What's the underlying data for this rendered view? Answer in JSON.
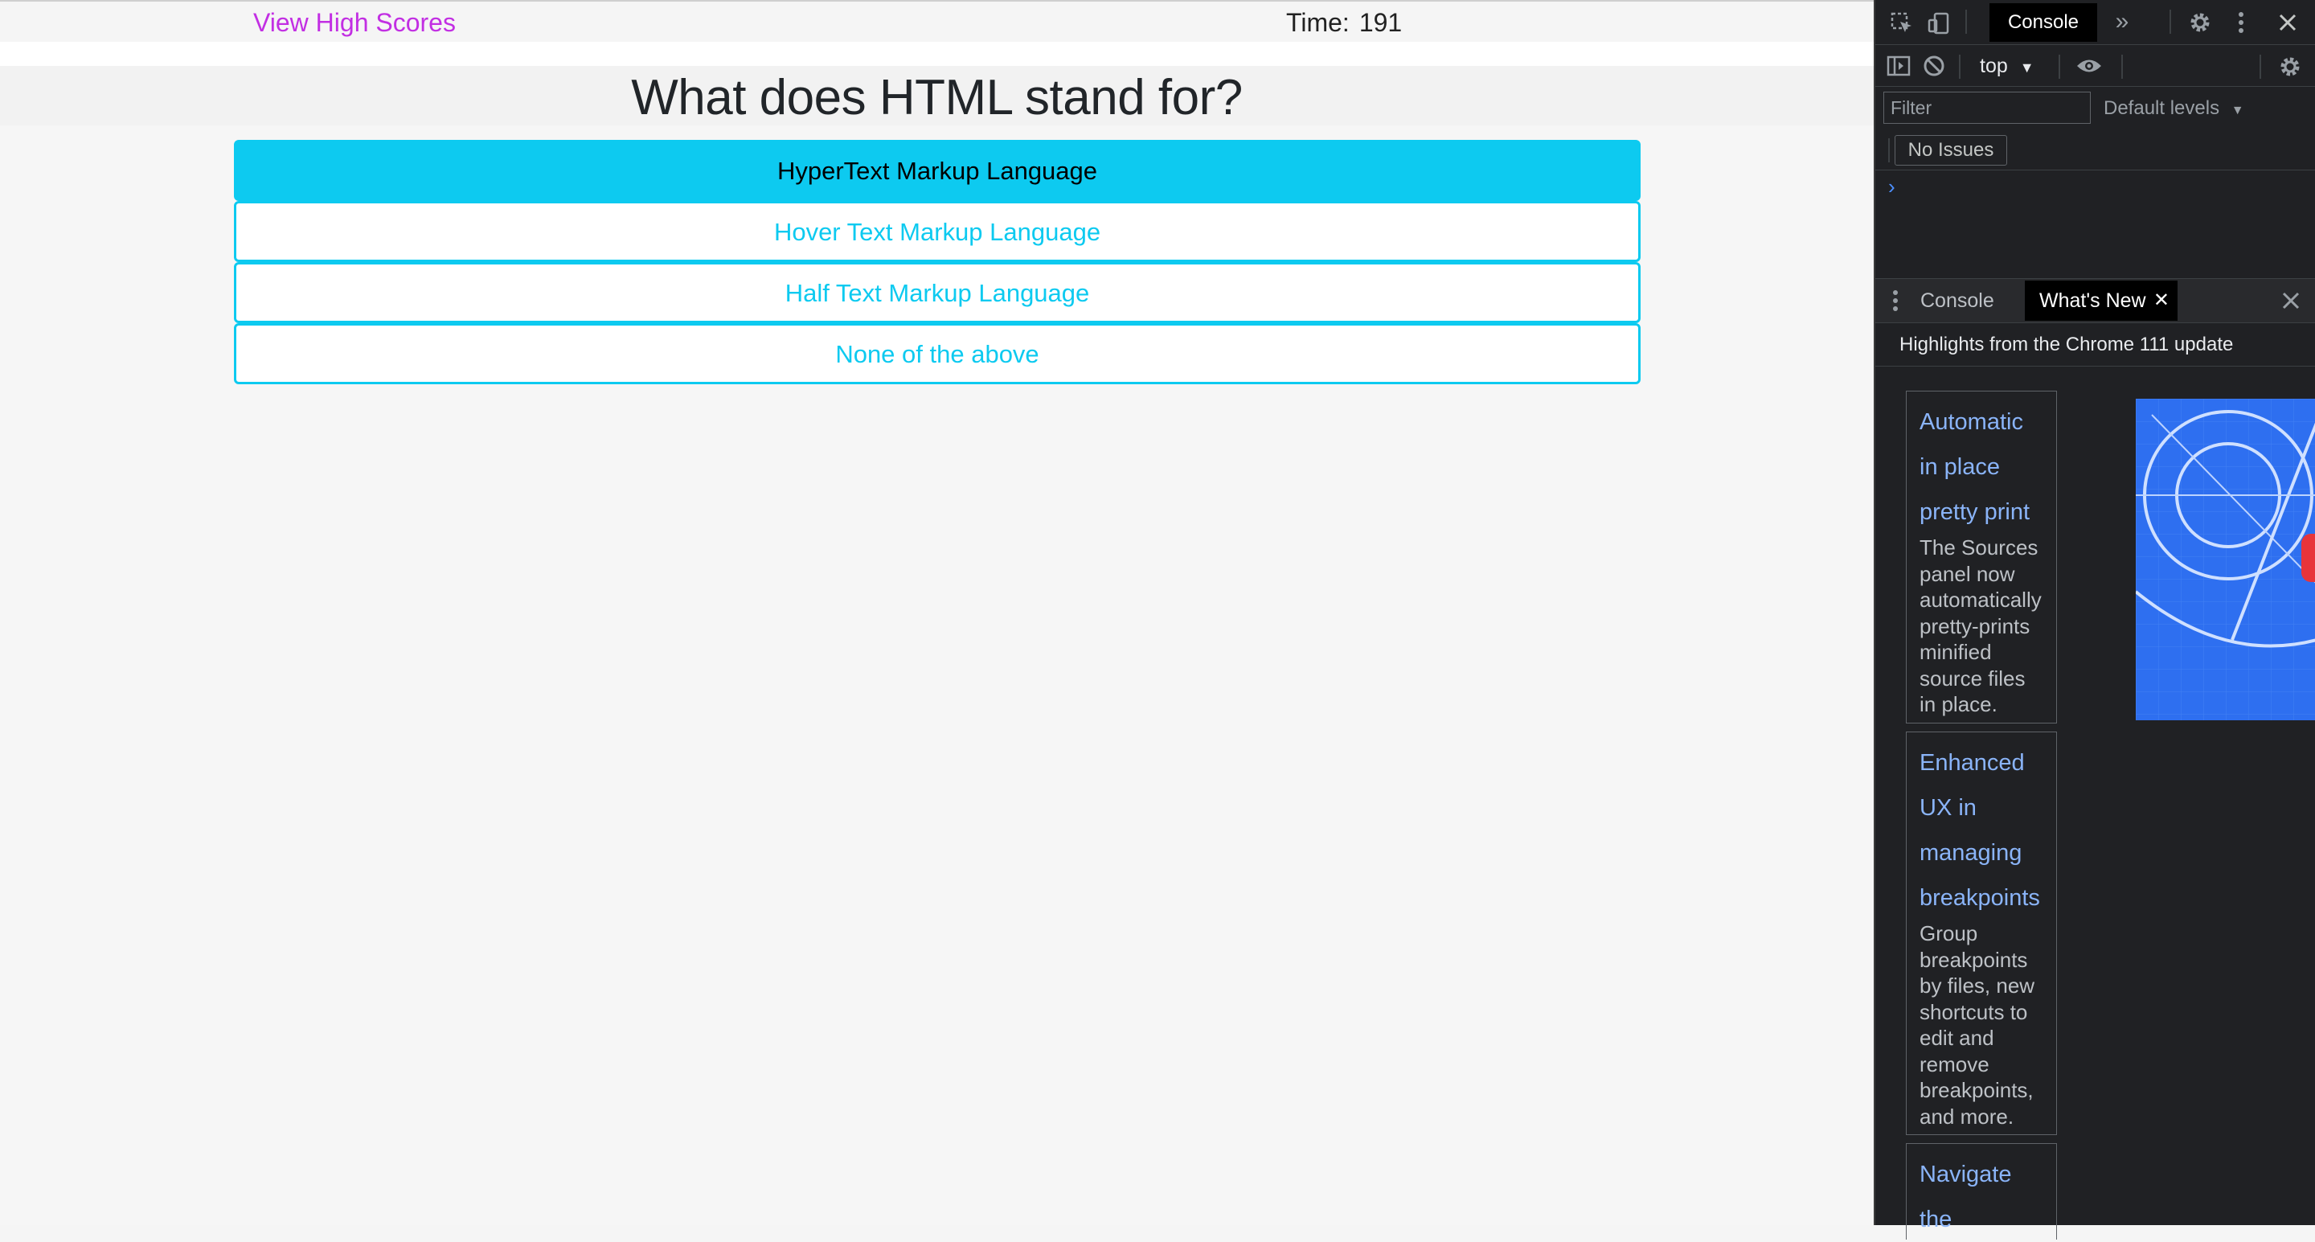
{
  "page": {
    "high_scores_link": "View High Scores",
    "timer_label": "Time:",
    "timer_value": "191",
    "question": "What does HTML stand for?",
    "answers": [
      "HyperText Markup Language",
      "Hover Text Markup Language",
      "Half Text Markup Language",
      "None of the above"
    ],
    "selected_answer_index": 0,
    "colors": {
      "accent": "#0dcaf0",
      "link": "#c22fe3"
    }
  },
  "devtools": {
    "main_tab": "Console",
    "context": "top",
    "filter_placeholder": "Filter",
    "levels": "Default levels",
    "issues": "No Issues",
    "prompt": "›",
    "drawer": {
      "tabs": [
        "Console",
        "What's New"
      ],
      "highlights": "Highlights from the Chrome 111 update",
      "cards": [
        {
          "title_lines": [
            "Automatic",
            "in place",
            "pretty print"
          ],
          "desc_lines": [
            "The Sources",
            "panel now",
            "automatically",
            "pretty-prints",
            "minified",
            "source files",
            "in place."
          ]
        },
        {
          "title_lines": [
            "Enhanced",
            "UX in",
            "managing",
            "breakpoints"
          ],
          "desc_lines": [
            "Group",
            "breakpoints",
            "by files, new",
            "shortcuts to",
            "edit and",
            "remove",
            "breakpoints,",
            "and more."
          ]
        },
        {
          "title_lines": [
            "Navigate",
            "the"
          ],
          "desc_lines": []
        }
      ]
    }
  }
}
